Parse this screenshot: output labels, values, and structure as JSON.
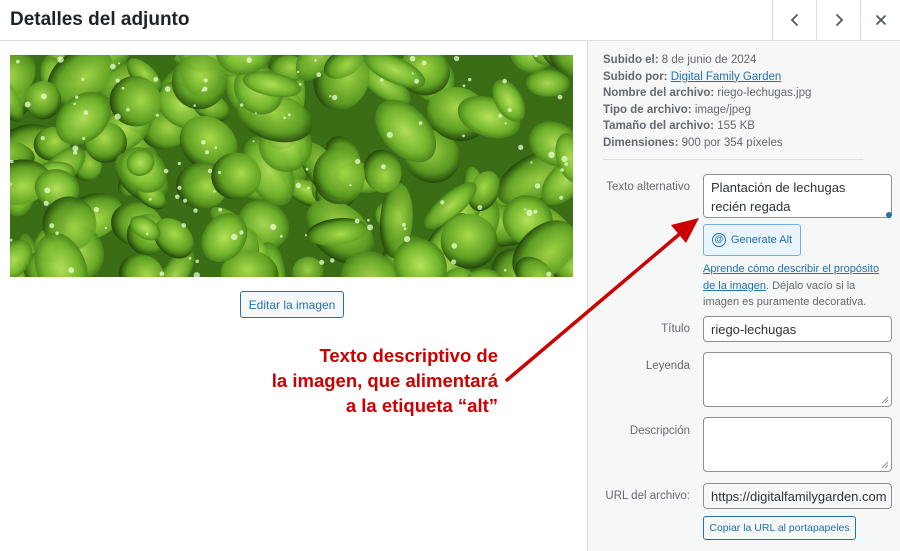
{
  "header": {
    "title": "Detalles del adjunto",
    "prev_icon": "chevron-left-icon",
    "next_icon": "chevron-right-icon",
    "close_icon": "close-icon"
  },
  "media": {
    "edit_button": "Editar la imagen"
  },
  "annotation": {
    "lines": [
      "Texto descriptivo de",
      "la imagen, que alimentará",
      "a la etiqueta “alt”"
    ],
    "color": "#cc0000"
  },
  "meta": {
    "uploaded_on_label": "Subido el:",
    "uploaded_on": "8 de junio de 2024",
    "uploaded_by_label": "Subido por:",
    "uploaded_by": "Digital Family Garden",
    "filename_label": "Nombre del archivo:",
    "filename": "riego-lechugas.jpg",
    "filetype_label": "Tipo de archivo:",
    "filetype": "image/jpeg",
    "filesize_label": "Tamaño del archivo:",
    "filesize": "155 KB",
    "dimensions_label": "Dimensiones:",
    "dimensions": "900 por 354 píxeles"
  },
  "fields": {
    "alt_label": "Texto alternativo",
    "alt_value": "Plantación de lechugas recién regada",
    "generate_alt": "Generate Alt",
    "help_link": "Aprende cómo describir el propósito de la imagen",
    "help_text": ". Déjalo vacío si la imagen es puramente decorativa.",
    "title_label": "Título",
    "title_value": "riego-lechugas",
    "caption_label": "Leyenda",
    "caption_value": "",
    "description_label": "Descripción",
    "description_value": "",
    "url_label": "URL del archivo:",
    "url_value": "https://digitalfamilygarden.com",
    "copy_button": "Copiar la URL al portapapeles"
  },
  "colors": {
    "accent": "#2271b1",
    "annotation": "#cc0000",
    "sidebar_bg": "#f6f7f7"
  }
}
